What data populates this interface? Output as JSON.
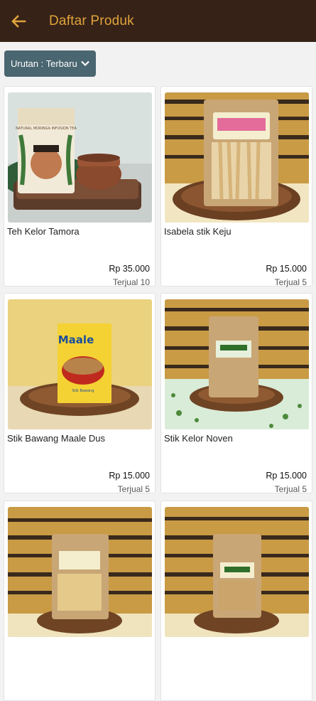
{
  "appbar": {
    "title": "Daftar Produk",
    "back_icon": "arrow-left-icon",
    "accent": "#e0a43c",
    "background": "#362217"
  },
  "sort": {
    "label": "Urutan : Terbaru",
    "icon": "chevron-down-icon",
    "background": "#4a6670"
  },
  "products": [
    {
      "name": "Teh Kelor Tamora",
      "price": "Rp 35.000",
      "sold": "Terjual 10"
    },
    {
      "name": "Isabela stik Keju",
      "price": "Rp 15.000",
      "sold": "Terjual 5"
    },
    {
      "name": "Stik Bawang Maale Dus",
      "price": "Rp 15.000",
      "sold": "Terjual 5"
    },
    {
      "name": "Stik Kelor Noven",
      "price": "Rp 15.000",
      "sold": "Terjual 5"
    },
    {
      "name": "",
      "price": "",
      "sold": ""
    },
    {
      "name": "",
      "price": "",
      "sold": ""
    }
  ],
  "image_text": {
    "tea_pouch": "NATURAL MORINGA INFUSION TEA",
    "maale_brand": "Maale",
    "maale_sub": "Stik Bawang"
  }
}
